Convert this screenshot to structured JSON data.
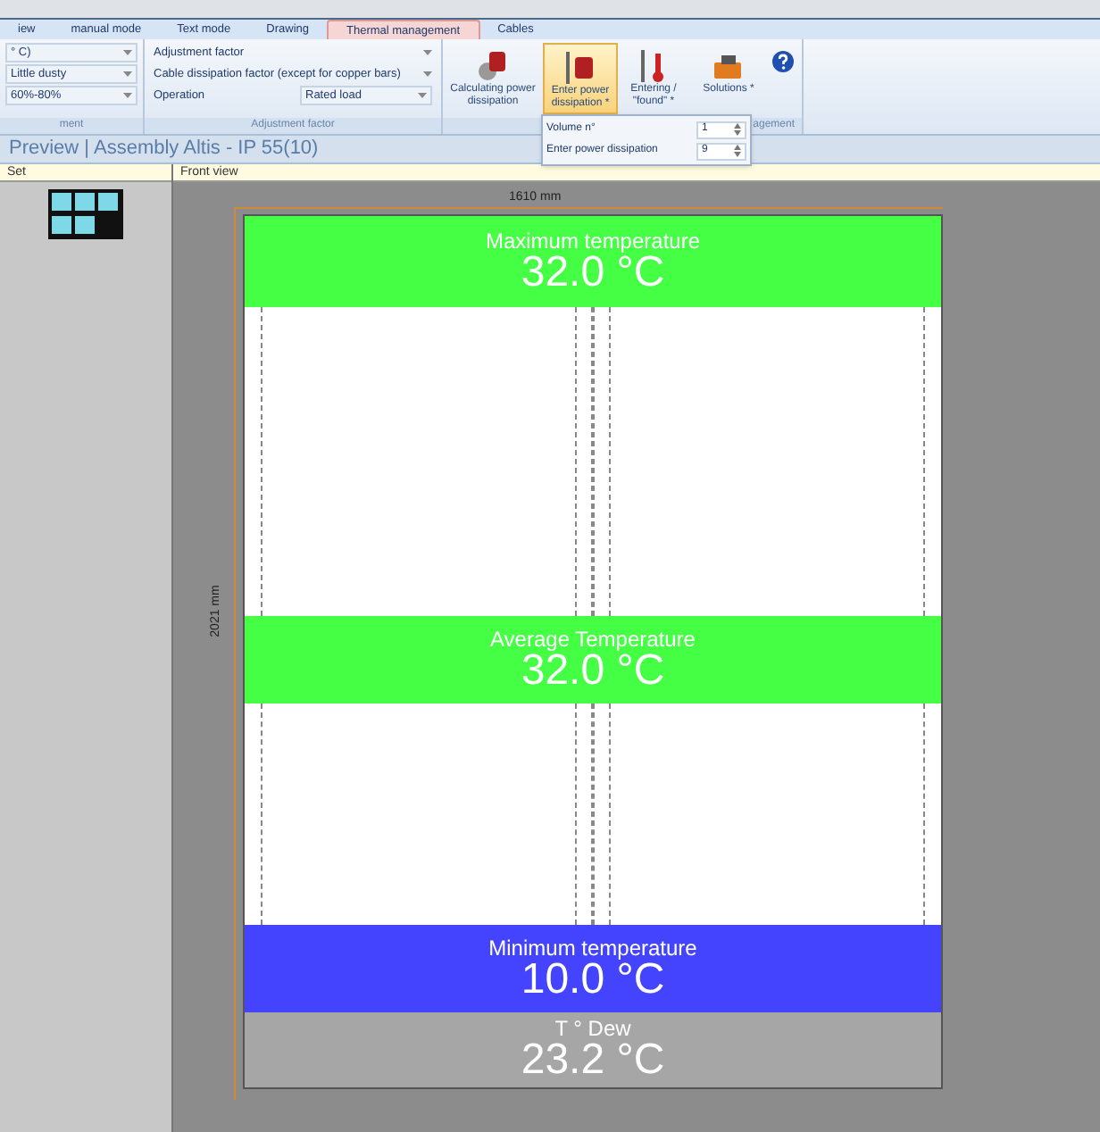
{
  "tabs": [
    {
      "label": "iew",
      "selected": false
    },
    {
      "label": "manual mode",
      "selected": false
    },
    {
      "label": "Text mode",
      "selected": false
    },
    {
      "label": "Drawing",
      "selected": false
    },
    {
      "label": "Thermal management",
      "selected": true
    },
    {
      "label": "Cables",
      "selected": false
    }
  ],
  "ribbon": {
    "environment_group": {
      "fields": [
        "° C)",
        "Little dusty",
        "60%-80%"
      ],
      "label": "ment"
    },
    "adjustment_group": {
      "fields": [
        {
          "label": "Adjustment factor"
        },
        {
          "label": "Cable dissipation factor (except for copper bars)"
        },
        {
          "label": "Operation",
          "value": "Rated load"
        }
      ],
      "label": "Adjustment factor"
    },
    "management_group": {
      "buttons": [
        {
          "label": "Calculating power dissipation",
          "highlighted": false
        },
        {
          "label": "Enter power dissipation *",
          "highlighted": true
        },
        {
          "label": "Entering / \"found\" *",
          "highlighted": false
        },
        {
          "label": "Solutions *",
          "highlighted": false
        }
      ],
      "label": "agement"
    }
  },
  "popup": {
    "rows": [
      {
        "label": "Volume n°",
        "value": "1"
      },
      {
        "label": "Enter power dissipation",
        "value": "9"
      }
    ]
  },
  "preview_title": "Preview | Assembly Altis - IP 55(10)",
  "set_panel": {
    "header": "Set"
  },
  "front_view": {
    "header": "Front view",
    "width_label": "1610 mm",
    "height_label": "2021 mm",
    "bands": [
      {
        "label": "Maximum temperature",
        "value": "32.0 °C",
        "color": "#44ff44"
      },
      {
        "label": "Average Temperature",
        "value": "32.0 °C",
        "color": "#44ff44"
      },
      {
        "label": "Minimum temperature",
        "value": "10.0 °C",
        "color": "#4444ff"
      },
      {
        "label": "T ° Dew",
        "value": "23.2 °C",
        "color": "#a6a6a6"
      }
    ]
  }
}
